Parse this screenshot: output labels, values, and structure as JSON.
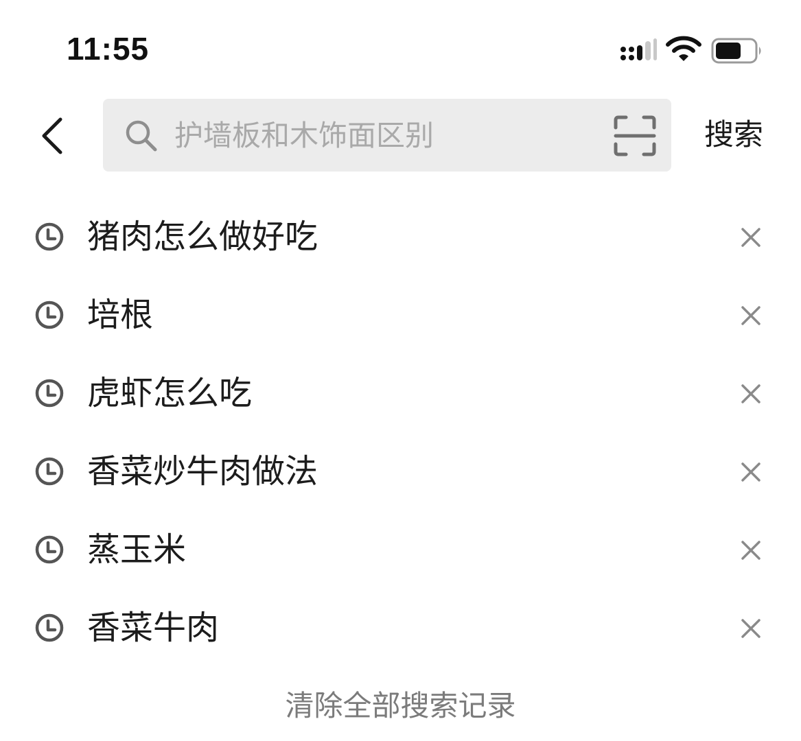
{
  "status_bar": {
    "time": "11:55",
    "icons": [
      "signal-icon",
      "wifi-icon",
      "battery-icon"
    ]
  },
  "header": {
    "back_icon": "chevron-left-icon",
    "search_placeholder": "护墙板和木饰面区别",
    "search_value": "",
    "scan_icon": "scan-icon",
    "search_button_label": "搜索"
  },
  "history": {
    "items": [
      {
        "label": "猪肉怎么做好吃"
      },
      {
        "label": "培根"
      },
      {
        "label": "虎虾怎么吃"
      },
      {
        "label": "香菜炒牛肉做法"
      },
      {
        "label": "蒸玉米"
      },
      {
        "label": "香菜牛肉"
      }
    ],
    "clear_all_label": "清除全部搜索记录"
  },
  "colors": {
    "search_box_bg": "#ececec",
    "placeholder": "#a9a9a9",
    "icon_gray": "#555555",
    "clear_text": "#7b7b7b"
  }
}
